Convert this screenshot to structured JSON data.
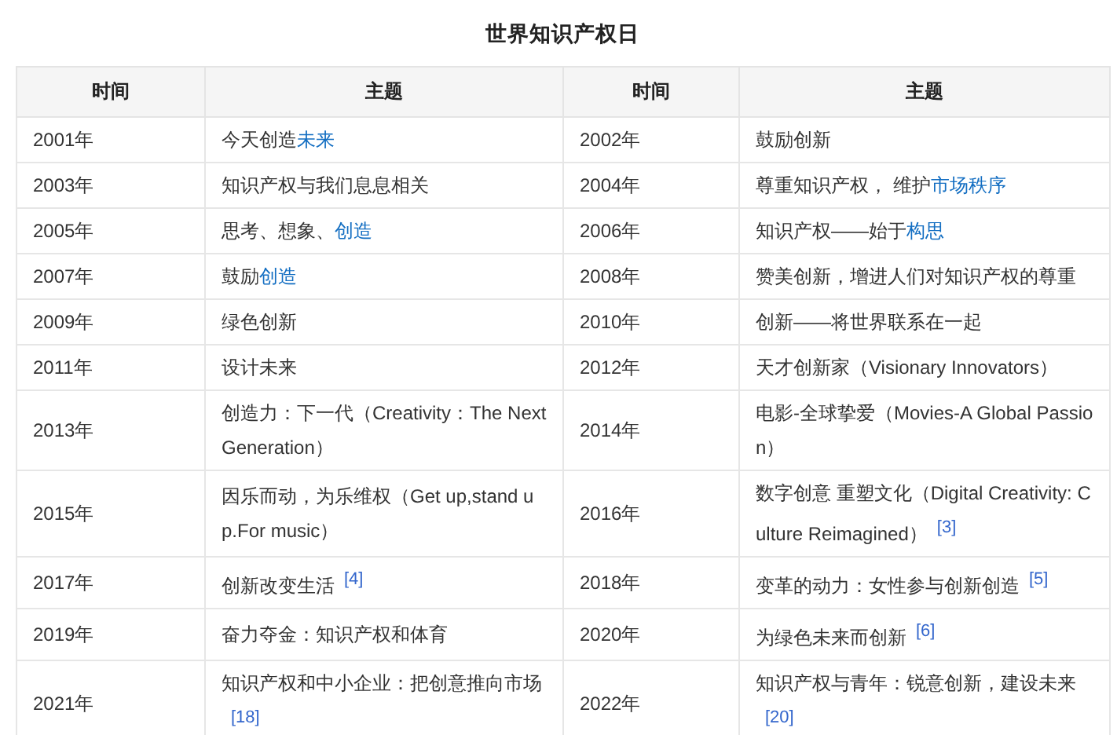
{
  "title": "世界知识产权日",
  "table": {
    "columns": [
      "时间",
      "主题",
      "时间",
      "主题"
    ],
    "rows": [
      [
        {
          "year": "2001年",
          "topic": [
            {
              "text": "今天创造",
              "link": false
            },
            {
              "text": "未来",
              "link": true
            }
          ]
        },
        {
          "year": "2002年",
          "topic": [
            {
              "text": "鼓励创新",
              "link": false
            }
          ]
        }
      ],
      [
        {
          "year": "2003年",
          "topic": [
            {
              "text": "知识产权与我们息息相关",
              "link": false
            }
          ]
        },
        {
          "year": "2004年",
          "topic": [
            {
              "text": "尊重知识产权， 维护",
              "link": false
            },
            {
              "text": "市场秩序",
              "link": true
            }
          ]
        }
      ],
      [
        {
          "year": "2005年",
          "topic": [
            {
              "text": "思考、想象、",
              "link": false
            },
            {
              "text": "创造",
              "link": true
            }
          ]
        },
        {
          "year": "2006年",
          "topic": [
            {
              "text": "知识产权——始于",
              "link": false
            },
            {
              "text": "构思",
              "link": true
            }
          ]
        }
      ],
      [
        {
          "year": "2007年",
          "topic": [
            {
              "text": "鼓励",
              "link": false
            },
            {
              "text": "创造",
              "link": true
            }
          ]
        },
        {
          "year": "2008年",
          "topic": [
            {
              "text": "赞美创新，增进人们对知识产权的尊重",
              "link": false
            }
          ]
        }
      ],
      [
        {
          "year": "2009年",
          "topic": [
            {
              "text": "绿色创新",
              "link": false
            }
          ]
        },
        {
          "year": "2010年",
          "topic": [
            {
              "text": "创新——将世界联系在一起",
              "link": false
            }
          ]
        }
      ],
      [
        {
          "year": "2011年",
          "topic": [
            {
              "text": "设计未来",
              "link": false
            }
          ]
        },
        {
          "year": "2012年",
          "topic": [
            {
              "text": "天才创新家（Visionary Innovators）",
              "link": false
            }
          ]
        }
      ],
      [
        {
          "year": "2013年",
          "topic": [
            {
              "text": "创造力：下一代（Creativity：The Next Generation）",
              "link": false
            }
          ]
        },
        {
          "year": "2014年",
          "topic": [
            {
              "text": "电影-全球挚爱（Movies-A Global Passion）",
              "link": false
            }
          ]
        }
      ],
      [
        {
          "year": "2015年",
          "topic": [
            {
              "text": "因乐而动，为乐维权（Get up,stand up.For music）",
              "link": false
            }
          ]
        },
        {
          "year": "2016年",
          "topic": [
            {
              "text": "数字创意 重塑文化（Digital Creativity: Culture Reimagined）",
              "link": false
            }
          ],
          "ref": "[3]"
        }
      ],
      [
        {
          "year": "2017年",
          "topic": [
            {
              "text": "创新改变生活",
              "link": false
            }
          ],
          "ref": "[4]"
        },
        {
          "year": "2018年",
          "topic": [
            {
              "text": "变革的动力：女性参与创新创造",
              "link": false
            }
          ],
          "ref": "[5]"
        }
      ],
      [
        {
          "year": "2019年",
          "topic": [
            {
              "text": "奋力夺金：知识产权和体育",
              "link": false
            }
          ]
        },
        {
          "year": "2020年",
          "topic": [
            {
              "text": "为绿色未来而创新",
              "link": false
            }
          ],
          "ref": "[6]"
        }
      ],
      [
        {
          "year": "2021年",
          "topic": [
            {
              "text": "知识产权和中小企业：把创意推向市场",
              "link": false
            }
          ],
          "ref": "[18]"
        },
        {
          "year": "2022年",
          "topic": [
            {
              "text": "知识产权与青年：锐意创新，建设未来",
              "link": false
            }
          ],
          "ref": "[20]"
        }
      ]
    ]
  }
}
